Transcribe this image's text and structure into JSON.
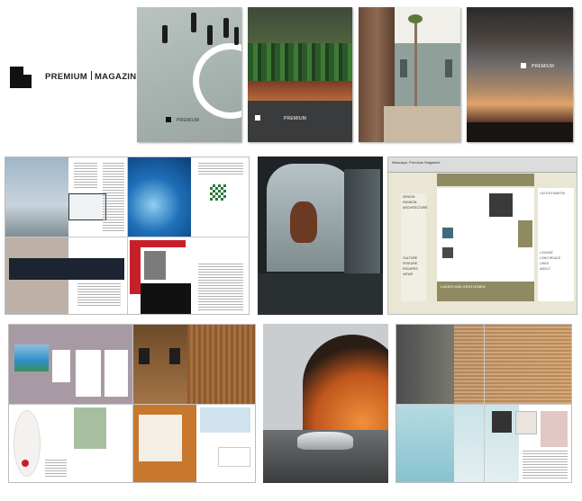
{
  "brand": {
    "name": "PREMIUM",
    "tagline": "MAGAZINE"
  },
  "covers": [
    {
      "label": "PREMIUM"
    },
    {
      "label": "PREMIUM"
    },
    {
      "label": ""
    },
    {
      "label": "PREMIUM"
    }
  ],
  "browser": {
    "title": "Netscape: Premium Magazine",
    "menu": [
      "DESIGN",
      "FASHION",
      "ARCHITECTURE",
      "CULTURE",
      "FEATURE",
      "ESCAPES",
      "VIEWS"
    ],
    "banner": "LADIES AND GENTLEMEN",
    "sidebar": [
      "LAYTON MARTIN",
      "LOUNGE",
      "LONG READS",
      "LINKS",
      "ABOUT"
    ]
  },
  "colors": {
    "pool_blue": "#2f7fc9",
    "accent_red": "#c8202a",
    "mauve": "#a89aa4",
    "olive_web": "#8f8a62",
    "orange_tunnel": "#e07a2a"
  }
}
